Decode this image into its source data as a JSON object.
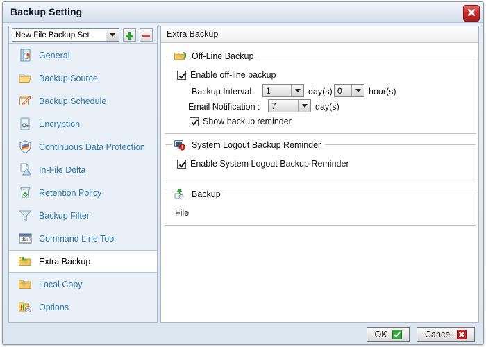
{
  "window": {
    "title": "Backup Setting",
    "close_icon": "close-x-icon",
    "accent_blue": "#2f7ab5",
    "close_red": "#cf2c2c"
  },
  "sidebar": {
    "toolbar": {
      "combo_value": "New File Backup Set",
      "combo_icon": "chevron-down-icon",
      "add_label": "+",
      "add_icon": "plus-icon",
      "add_color": "#25a428",
      "remove_label": "-",
      "remove_icon": "minus-icon",
      "remove_color": "#d64545"
    },
    "items": [
      {
        "label": "General",
        "icon": "document-chart-icon",
        "selected": false
      },
      {
        "label": "Backup Source",
        "icon": "folder-open-icon",
        "selected": false
      },
      {
        "label": "Backup Schedule",
        "icon": "note-pencil-icon",
        "selected": false
      },
      {
        "label": "Encryption",
        "icon": "document-key-icon",
        "selected": false
      },
      {
        "label": "Continuous Data Protection",
        "icon": "shield-icon",
        "selected": false
      },
      {
        "label": "In-File Delta",
        "icon": "page-delta-icon",
        "selected": false
      },
      {
        "label": "Retention Policy",
        "icon": "recycle-bin-icon",
        "selected": false
      },
      {
        "label": "Backup Filter",
        "icon": "funnel-icon",
        "selected": false
      },
      {
        "label": "Command Line Tool",
        "icon": "console-window-icon",
        "selected": false
      },
      {
        "label": "Extra Backup",
        "icon": "folder-up-down-arrows-icon",
        "selected": true
      },
      {
        "label": "Local Copy",
        "icon": "folder-down-arrow-icon",
        "selected": false
      },
      {
        "label": "Options",
        "icon": "folder-gear-icon",
        "selected": false
      }
    ]
  },
  "content": {
    "header": "Extra Backup",
    "groups": {
      "offline": {
        "title": "Off-Line Backup",
        "icon": "offline-sync-icon",
        "enable_label": "Enable off-line backup",
        "enable_checked": true,
        "interval_label": "Backup Interval :",
        "interval_days_value": "1",
        "interval_days_unit": "day(s)",
        "interval_hours_value": "0",
        "interval_hours_unit": "hour(s)",
        "email_label": "Email Notification :",
        "email_days_value": "7",
        "email_days_unit": "day(s)",
        "reminder_label": "Show backup reminder",
        "reminder_checked": true
      },
      "logout": {
        "title": "System Logout Backup Reminder",
        "icon": "monitor-alert-icon",
        "enable_label": "Enable System Logout Backup Reminder",
        "enable_checked": true
      },
      "backup": {
        "title": "Backup",
        "icon": "upload-arrow-icon",
        "body_text": "File"
      }
    }
  },
  "footer": {
    "ok_label": "OK",
    "ok_icon": "green-check-icon",
    "ok_color": "#2faa38",
    "cancel_label": "Cancel",
    "cancel_icon": "red-x-icon",
    "cancel_color": "#cc2222"
  }
}
